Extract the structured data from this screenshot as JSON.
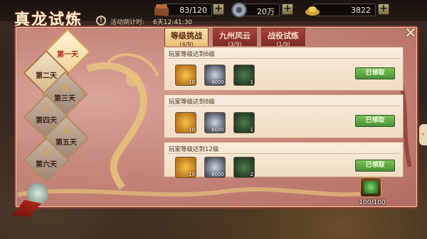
{
  "title": "真龙试炼",
  "timer": {
    "label": "活动倒计时:",
    "value": "6天12:41:30"
  },
  "resources": [
    {
      "name": "energy",
      "icon": "wood-stack-icon",
      "value": "83/120"
    },
    {
      "name": "silver",
      "icon": "silver-coin-icon",
      "value": "20万"
    },
    {
      "name": "gold",
      "icon": "gold-ingot-icon",
      "value": "3822"
    }
  ],
  "tabs": [
    {
      "name": "等级挑战",
      "count": "(4/9)",
      "active": true
    },
    {
      "name": "九州风云",
      "count": "(3/9)",
      "active": false
    },
    {
      "name": "战役试炼",
      "count": "(1/9)",
      "active": false
    }
  ],
  "days": [
    {
      "label": "第一天",
      "state": "active"
    },
    {
      "label": "第二天",
      "state": "selected"
    },
    {
      "label": "第三天",
      "state": "locked"
    },
    {
      "label": "第四天",
      "state": "locked"
    },
    {
      "label": "第五天",
      "state": "locked"
    },
    {
      "label": "第六天",
      "state": "locked"
    }
  ],
  "tasks": [
    {
      "title": "玩家等级达到6级",
      "rewards": [
        {
          "icon": "gold-shard-icon",
          "qty": "10"
        },
        {
          "icon": "silver-coin-icon",
          "qty": "4000"
        },
        {
          "icon": "book-icon",
          "qty": "1"
        }
      ],
      "button": "已领取"
    },
    {
      "title": "玩家等级达到8级",
      "rewards": [
        {
          "icon": "gold-shard-icon",
          "qty": "10"
        },
        {
          "icon": "silver-coin-icon",
          "qty": "6000"
        },
        {
          "icon": "book-icon",
          "qty": "1"
        }
      ],
      "button": "已领取"
    },
    {
      "title": "玩家等级达到12级",
      "rewards": [
        {
          "icon": "gold-shard-icon",
          "qty": "10"
        },
        {
          "icon": "silver-coin-icon",
          "qty": "8000"
        },
        {
          "icon": "book-icon",
          "qty": "2"
        }
      ],
      "button": "已领取"
    }
  ],
  "chest": {
    "progress": "100/100"
  },
  "colors": {
    "panel": "#c98a80",
    "accent_red": "#8a3b2f",
    "claimed_green": "#5da83e",
    "gold": "#e6c27a"
  }
}
